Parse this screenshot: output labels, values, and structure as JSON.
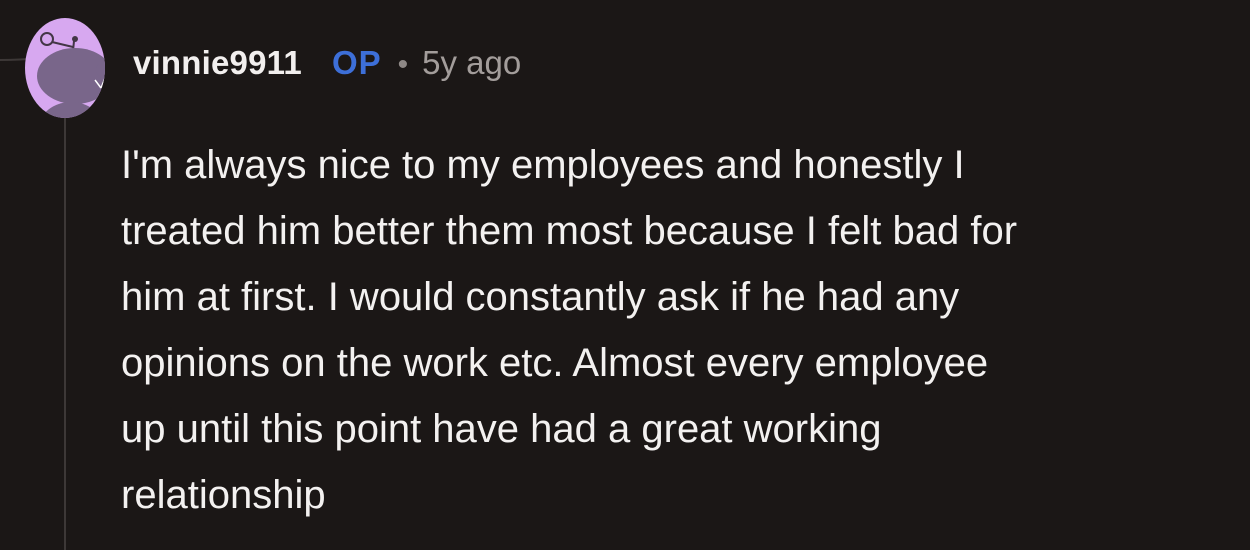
{
  "comment": {
    "author": "vinnie9911",
    "op_badge": "OP",
    "separator": "•",
    "timestamp": "5y ago",
    "body": "I'm always nice to my employees and honestly I\ntreated him better them most because I felt bad for\nhim at first. I would constantly ask if he had any\nopinions on the work etc. Almost every employee\nup until this point have had a great working\nrelationship",
    "avatar_icon": "reddit-snoo-avatar-icon"
  },
  "colors": {
    "background": "#1b1716",
    "op_badge": "#3d6fd8",
    "avatar_bg": "#d7a8f0",
    "text": "#f3f1f0",
    "muted": "#a39d9b"
  }
}
